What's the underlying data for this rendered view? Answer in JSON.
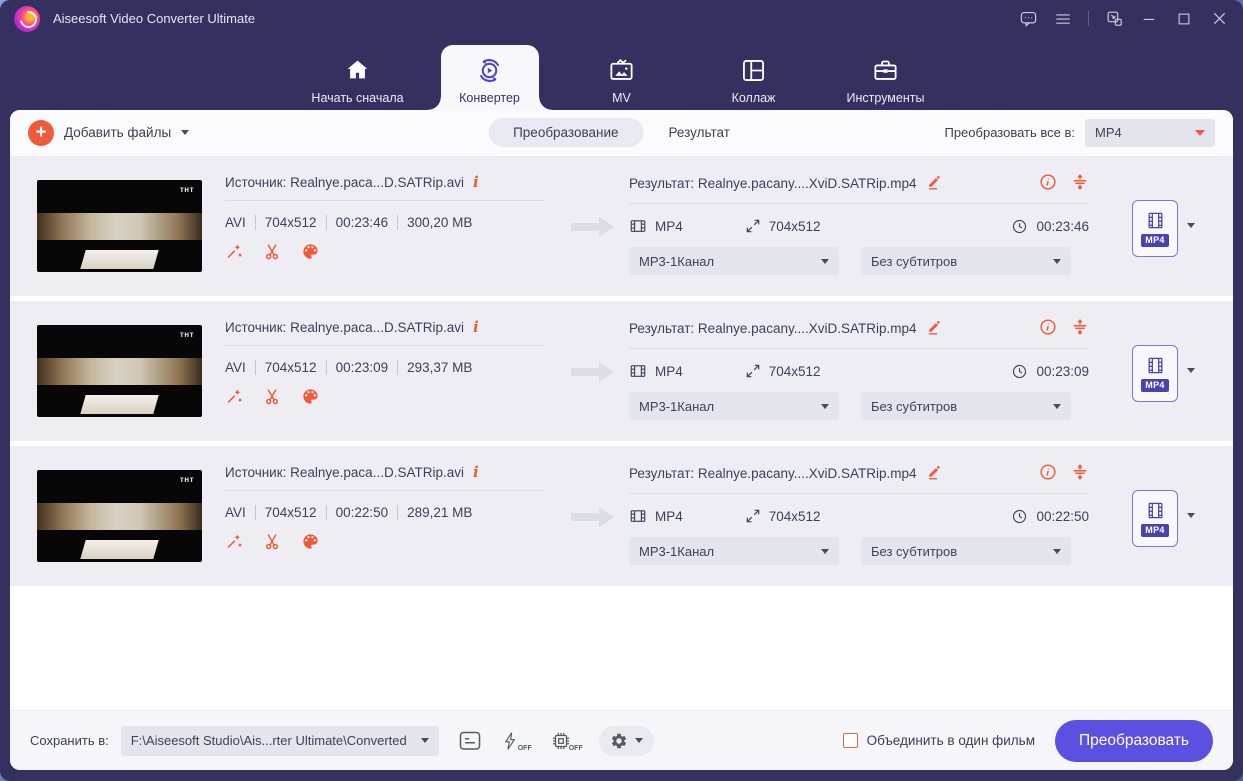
{
  "colors": {
    "accent_orange": "#ee5a3a",
    "primary_purple": "#5b50df",
    "badge_purple": "#4a43ae",
    "window_bg": "#343160"
  },
  "titlebar": {
    "title": "Aiseesoft Video Converter Ultimate"
  },
  "nav": {
    "tabs": [
      {
        "label": "Начать сначала"
      },
      {
        "label": "Конвертер"
      },
      {
        "label": "MV"
      },
      {
        "label": "Коллаж"
      },
      {
        "label": "Инструменты"
      }
    ]
  },
  "toolbar": {
    "add_files": "Добавить файлы",
    "segment_convert": "Преобразование",
    "segment_result": "Результат",
    "convert_all_label": "Преобразовать все в:",
    "convert_all_value": "MP4"
  },
  "files": [
    {
      "source": "Источник: Realnye.paca...D.SATRip.avi",
      "watermark": "тнт",
      "format": "AVI",
      "resolution": "704x512",
      "duration": "00:23:46",
      "size": "300,20 MB",
      "result": "Результат: Realnye.pacany....XviD.SATRip.mp4",
      "out_format": "MP4",
      "out_resolution": "704x512",
      "out_duration": "00:23:46",
      "audio_track": "MP3-1Канал",
      "subtitle": "Без субтитров",
      "badge": "MP4"
    },
    {
      "source": "Источник: Realnye.paca...D.SATRip.avi",
      "watermark": "тнт",
      "format": "AVI",
      "resolution": "704x512",
      "duration": "00:23:09",
      "size": "293,37 MB",
      "result": "Результат: Realnye.pacany....XviD.SATRip.mp4",
      "out_format": "MP4",
      "out_resolution": "704x512",
      "out_duration": "00:23:09",
      "audio_track": "MP3-1Канал",
      "subtitle": "Без субтитров",
      "badge": "MP4"
    },
    {
      "source": "Источник: Realnye.paca...D.SATRip.avi",
      "watermark": "тнт",
      "format": "AVI",
      "resolution": "704x512",
      "duration": "00:22:50",
      "size": "289,21 MB",
      "result": "Результат: Realnye.pacany....XviD.SATRip.mp4",
      "out_format": "MP4",
      "out_resolution": "704x512",
      "out_duration": "00:22:50",
      "audio_track": "MP3-1Канал",
      "subtitle": "Без субтитров",
      "badge": "MP4"
    }
  ],
  "footer": {
    "save_label": "Сохранить в:",
    "save_path": "F:\\Aiseesoft Studio\\Ais...rter Ultimate\\Converted",
    "off": "OFF",
    "merge_label": "Объединить в один фильм",
    "convert_button": "Преобразовать"
  }
}
